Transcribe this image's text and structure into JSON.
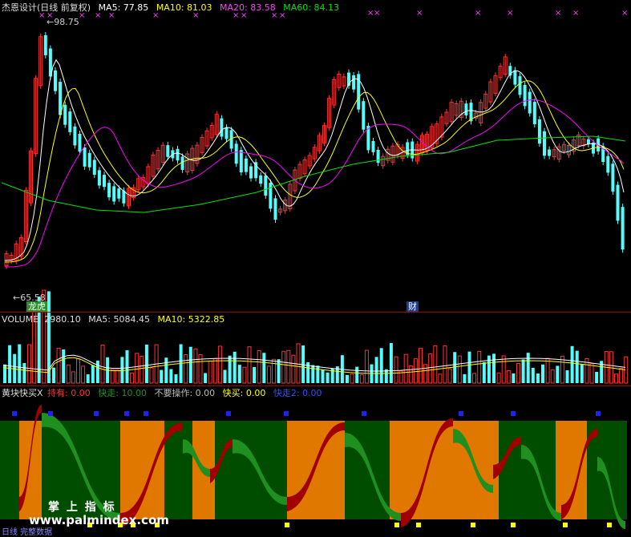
{
  "title_bar": {
    "name": "杰恩设计(日线 前复权)",
    "ma5": "MA5: 77.85",
    "ma10": "MA10: 81.03",
    "ma20": "MA20: 83.58",
    "ma60": "MA60: 84.13"
  },
  "price_panel": {
    "high_label": "98.75",
    "low_label": "65.58",
    "badge_dragon": "龙虎",
    "badge_fin": "财"
  },
  "volume_panel": {
    "volume": "VOLUME: 2980.10",
    "ma5": "MA5: 5084.45",
    "ma10": "MA10: 5322.85"
  },
  "indicator_panel": {
    "name": "黄块快买X",
    "hold": "持有: 0.00",
    "fast_sell": "快走: 10.00",
    "no_op": "不要操作: 0.00",
    "fast_buy": "快买: 0.00",
    "fast_sell2": "快走2: 0.00"
  },
  "watermark": {
    "cn": "掌 上 指 标",
    "url": "www.palmindex.com",
    "bottom_label": "日线 完整数据"
  },
  "colors": {
    "up": "#ff3232",
    "down": "#54fcfc",
    "ma5": "#ffffff",
    "ma10": "#ffff00",
    "ma20": "#ff00ff",
    "ma60": "#00e600",
    "divider": "#a00000",
    "hold_zone": "#e07800",
    "green_zone": "#004d00",
    "dark_red": "#a00000",
    "mid_green": "#1f8f1f"
  },
  "icons": [
    "cross-marker-icon",
    "square-marker-icon",
    "arrow-left-icon"
  ]
}
